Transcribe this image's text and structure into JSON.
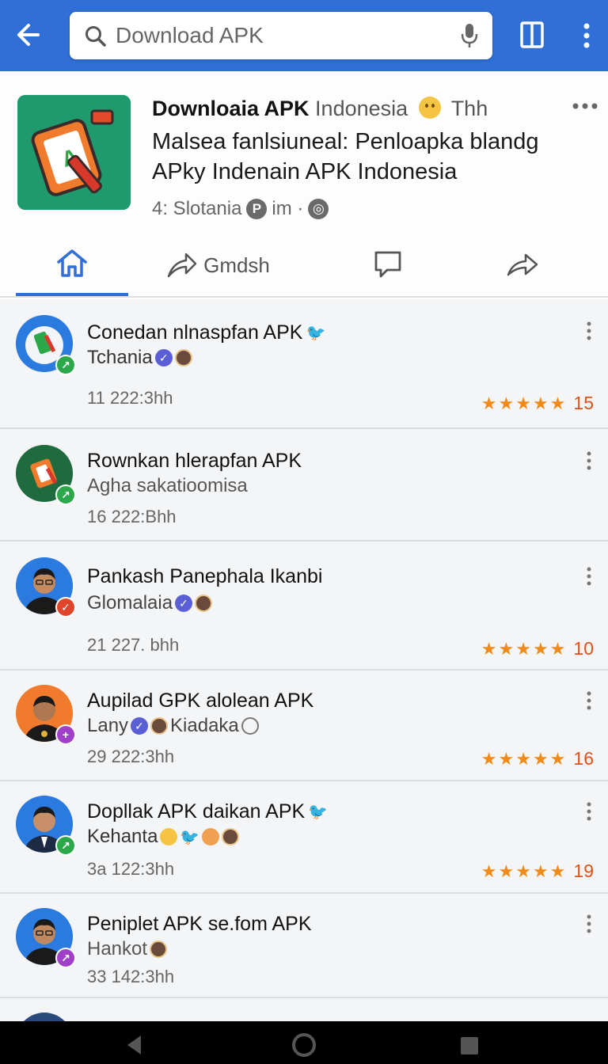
{
  "search": {
    "placeholder": "Download APK"
  },
  "header": {
    "title_bold": "Downloaia APK",
    "title_light": "Indonesia",
    "title_suffix": "Thh",
    "description": "Malsea fanlsiuneal: Penloapka blandg APky Indenain APK Indonesia",
    "meta_text": "4: Slotania",
    "meta_badge_1": "P",
    "meta_mid": "im ·",
    "meta_badge_2": "◎"
  },
  "tabs": {
    "share_label": "Gmdsh"
  },
  "items": [
    {
      "title": "Conedan nlnaspfan APK",
      "sub": "Tchania",
      "time": "11 222:3hh",
      "rating": "15"
    },
    {
      "title": "Rownkan hlerapfan APK",
      "sub": "Agha sakatioomisa",
      "time": "16 222:Bhh",
      "rating": ""
    },
    {
      "title": "Pankash Panephala Ikanbi",
      "sub": "Glomalaia",
      "time": "21 227. bhh",
      "rating": "10"
    },
    {
      "title": "Aupilad GPK alolean APK",
      "sub": "Lany",
      "sub_extra": "Kiadaka",
      "time": "29 222:3hh",
      "rating": "16"
    },
    {
      "title": "Dopllak APK daikan APK",
      "sub": "Kehanta",
      "time": "3a 122:3hh",
      "rating": "19"
    },
    {
      "title": "Peniplet APK se.fom APK",
      "sub": "Hankot",
      "time": "33 142:3hh",
      "rating": ""
    }
  ],
  "colors": {
    "primary": "#2f6fd6",
    "star": "#f08a18",
    "rating_text": "#e0501a"
  }
}
